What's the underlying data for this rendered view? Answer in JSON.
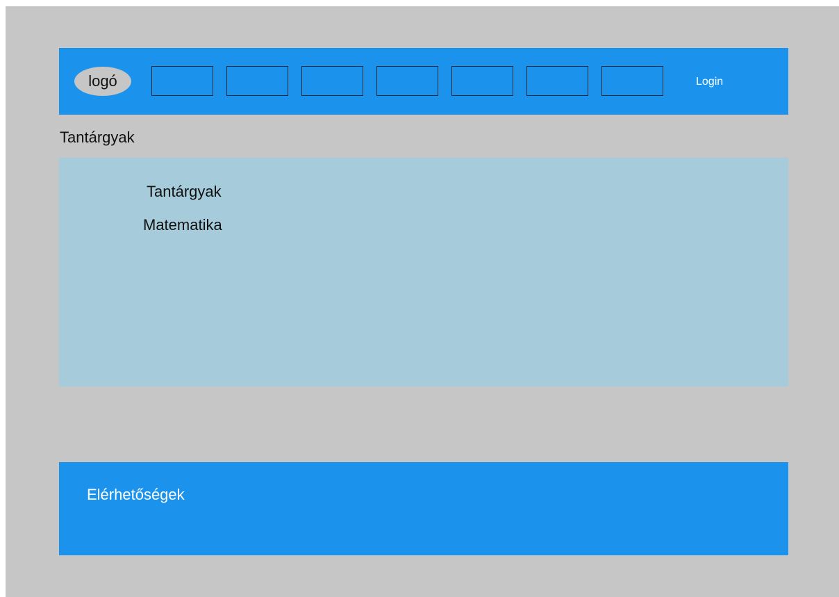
{
  "header": {
    "logo_text": "logó",
    "login_label": "Login",
    "nav_items": [
      "",
      "",
      "",
      "",
      "",
      "",
      ""
    ]
  },
  "page": {
    "title": "Tantárgyak"
  },
  "content": {
    "heading": "Tantárgyak",
    "subjects": [
      "Matematika"
    ]
  },
  "footer": {
    "contact_label": "Elérhetőségek"
  },
  "colors": {
    "canvas": "#c6c6c6",
    "header": "#1b92ec",
    "content": "#a6cbdb",
    "footer": "#1b92ec"
  }
}
